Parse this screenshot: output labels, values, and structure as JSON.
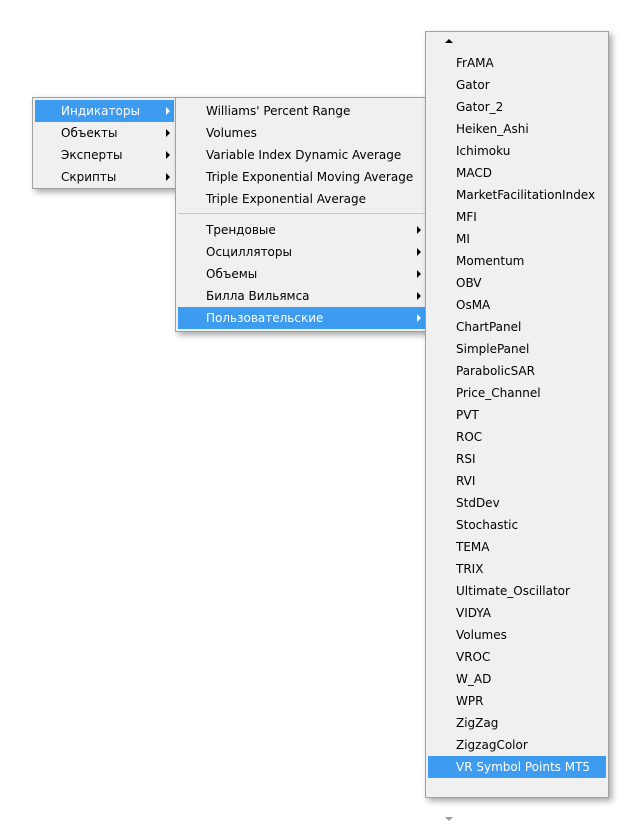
{
  "menu_main": {
    "items": [
      {
        "label": "Индикаторы",
        "has_submenu": true,
        "selected": true
      },
      {
        "label": "Объекты",
        "has_submenu": true,
        "selected": false
      },
      {
        "label": "Эксперты",
        "has_submenu": true,
        "selected": false
      },
      {
        "label": "Скрипты",
        "has_submenu": true,
        "selected": false
      }
    ]
  },
  "menu_indicators": {
    "recent": [
      "Williams' Percent Range",
      "Volumes",
      "Variable Index Dynamic Average",
      "Triple Exponential Moving Average",
      "Triple Exponential Average"
    ],
    "categories": [
      {
        "label": "Трендовые",
        "selected": false
      },
      {
        "label": "Осцилляторы",
        "selected": false
      },
      {
        "label": "Объемы",
        "selected": false
      },
      {
        "label": "Билла Вильямса",
        "selected": false
      },
      {
        "label": "Пользовательские",
        "selected": true
      }
    ]
  },
  "menu_custom": {
    "items": [
      "FrAMA",
      "Gator",
      "Gator_2",
      "Heiken_Ashi",
      "Ichimoku",
      "MACD",
      "MarketFacilitationIndex",
      "MFI",
      "MI",
      "Momentum",
      "OBV",
      "OsMA",
      "ChartPanel",
      "SimplePanel",
      "ParabolicSAR",
      "Price_Channel",
      "PVT",
      "ROC",
      "RSI",
      "RVI",
      "StdDev",
      "Stochastic",
      "TEMA",
      "TRIX",
      "Ultimate_Oscillator",
      "VIDYA",
      "Volumes",
      "VROC",
      "W_AD",
      "WPR",
      "ZigZag",
      "ZigzagColor",
      "VR Symbol Points MT5"
    ],
    "selected_index": 32
  },
  "colors": {
    "selection": "#3d9cf0",
    "menu_bg": "#f0f0f0",
    "border": "#a0a0a0"
  }
}
